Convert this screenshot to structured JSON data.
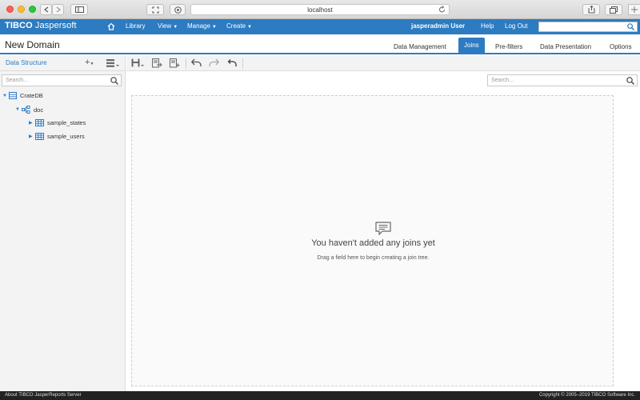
{
  "browser": {
    "address": "localhost"
  },
  "header": {
    "logo_brand": "TIBCO",
    "logo_product": " Jaspersoft",
    "nav": [
      {
        "label": "Library"
      },
      {
        "label": "View"
      },
      {
        "label": "Manage"
      },
      {
        "label": "Create"
      }
    ],
    "user": "jasperadmin User",
    "help": "Help",
    "logout": "Log Out",
    "search_placeholder": ""
  },
  "page": {
    "title": "New Domain",
    "tabs": [
      {
        "label": "Data Management"
      },
      {
        "label": "Joins",
        "active": true
      },
      {
        "label": "Pre-filters"
      },
      {
        "label": "Data Presentation"
      },
      {
        "label": "Options"
      }
    ]
  },
  "left_panel": {
    "title": "Data Structure",
    "search_placeholder": "Search...",
    "tree": [
      {
        "label": "CrateDB",
        "icon": "database-icon"
      },
      {
        "label": "doc",
        "icon": "schema-icon"
      },
      {
        "label": "sample_states",
        "icon": "table-icon"
      },
      {
        "label": "sample_users",
        "icon": "table-icon"
      }
    ]
  },
  "main": {
    "search_placeholder": "Search...",
    "empty_title": "You haven't added any joins yet",
    "empty_subtitle": "Drag a field here to begin creating a join tree."
  },
  "footer": {
    "left": "About TIBCO JasperReports Server",
    "right": "Copyright © 2005–2019 TIBCO Software Inc."
  },
  "colors": {
    "accent": "#2d7bc1",
    "footer_bg": "#222222"
  }
}
